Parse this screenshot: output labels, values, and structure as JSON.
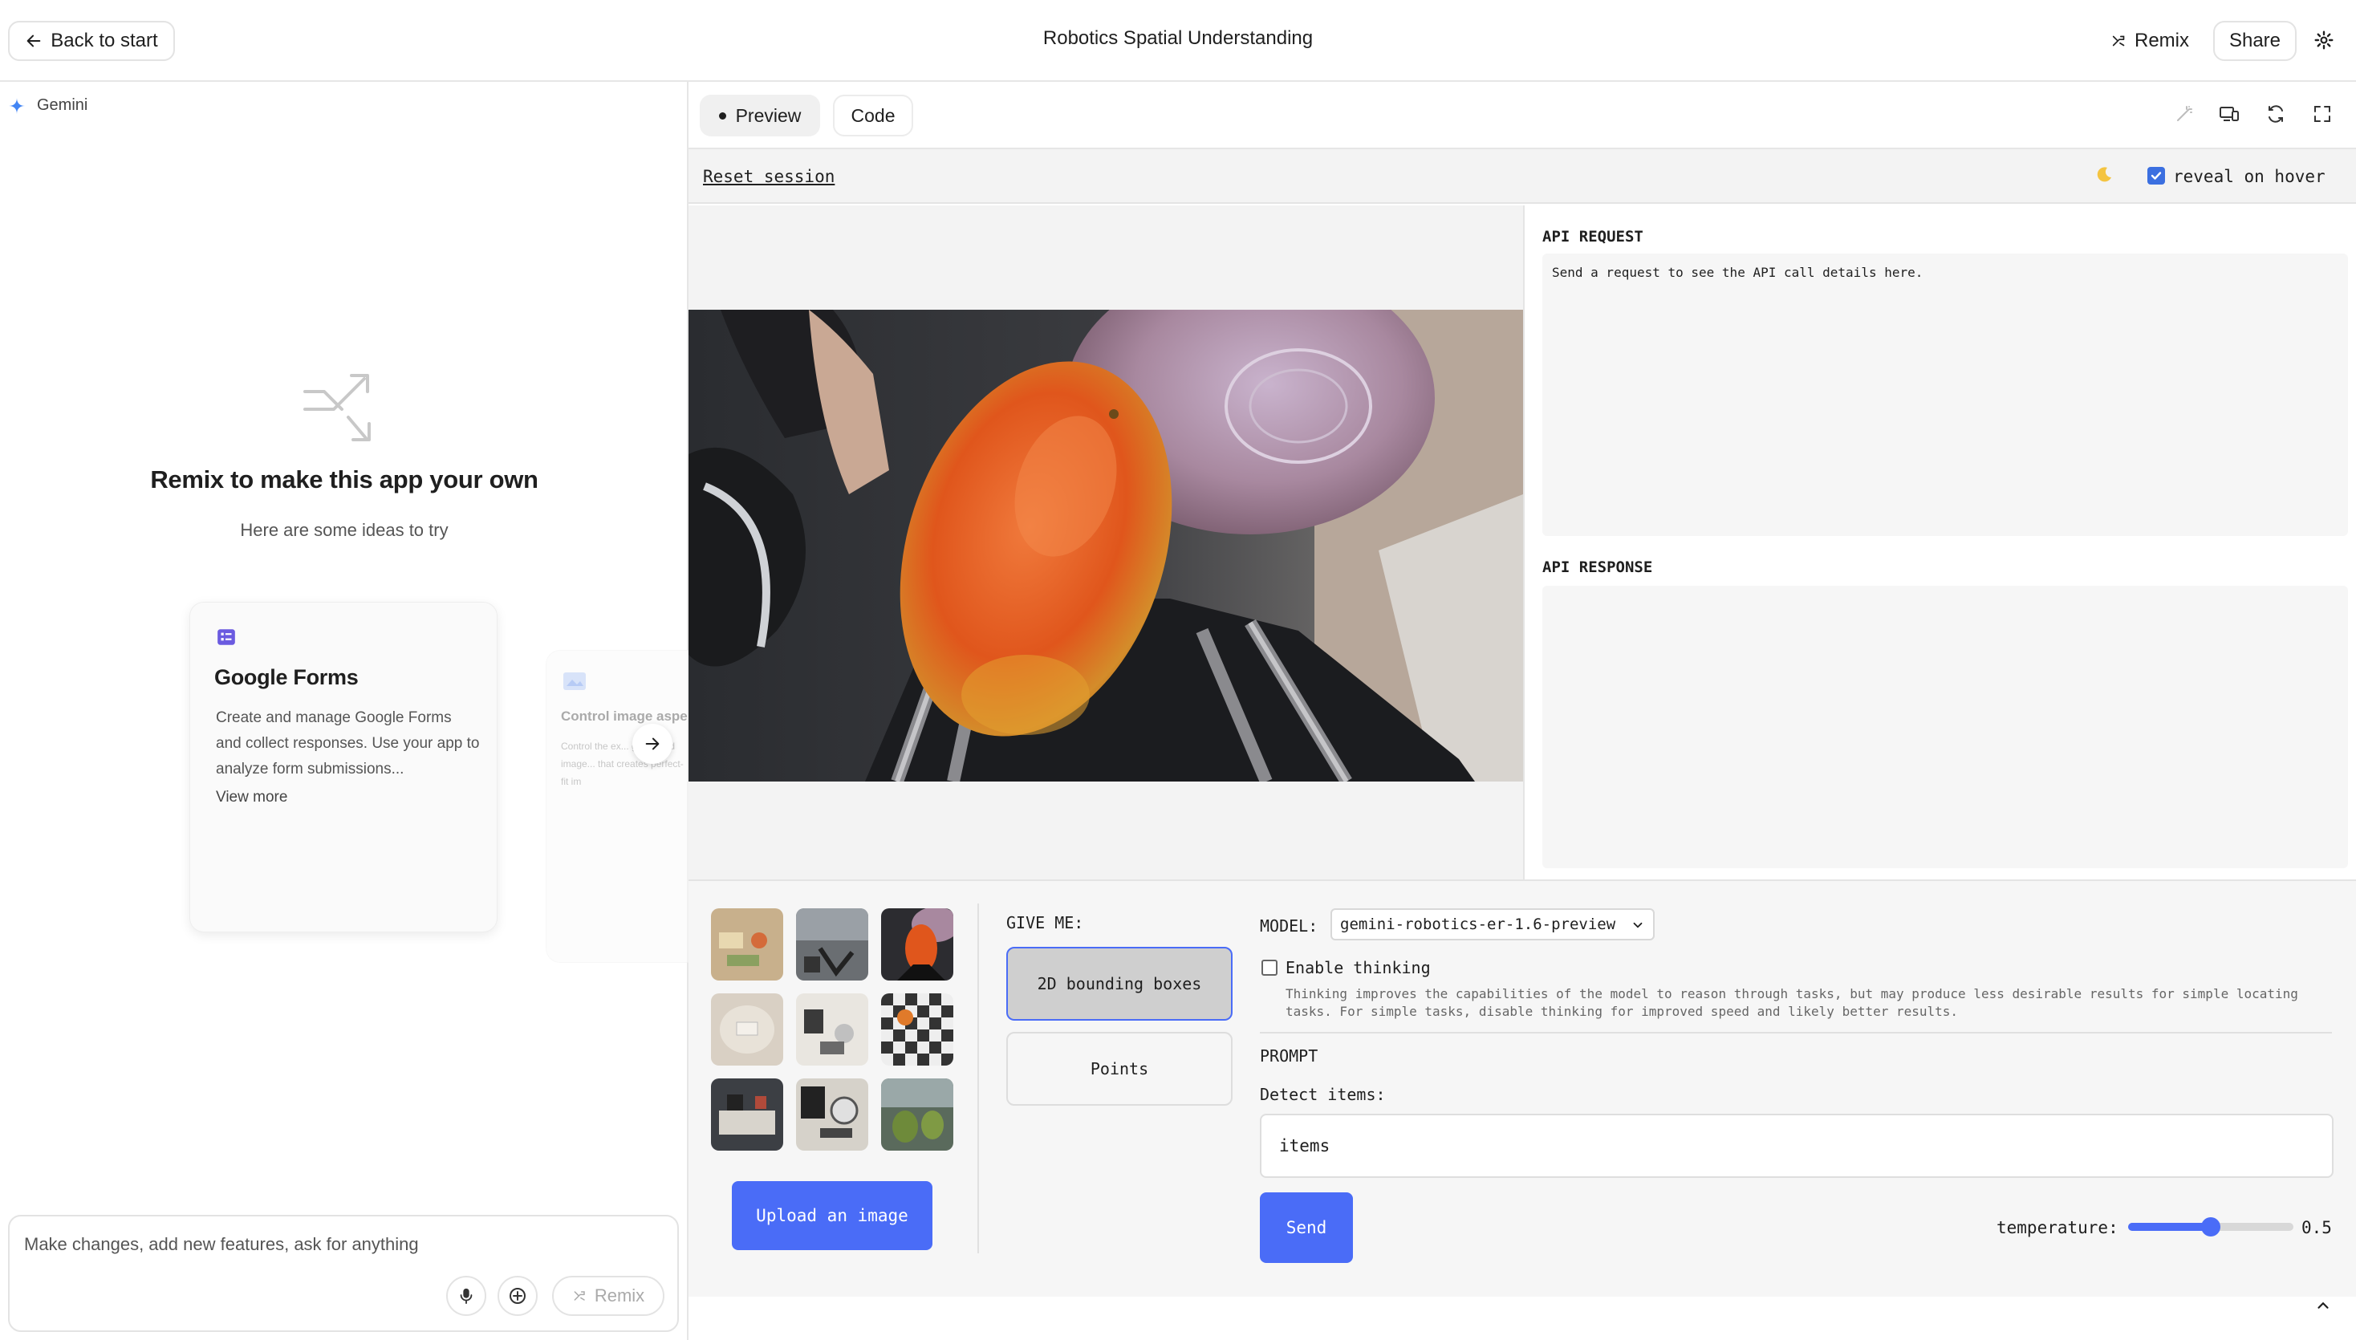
{
  "topbar": {
    "back_label": "Back to start",
    "title": "Robotics Spatial Understanding",
    "remix_label": "Remix",
    "share_label": "Share"
  },
  "left": {
    "model_label": "Gemini",
    "remix_heading": "Remix to make this app your own",
    "ideas_sub": "Here are some ideas to try",
    "card1": {
      "title": "Google Forms",
      "description": "Create and manage Google Forms and collect responses. Use your app to analyze form submissions...",
      "link": "View more"
    },
    "card2": {
      "title": "Control image aspe",
      "description": "Control the ex... generated image... that creates perfect-fit im"
    },
    "chat_placeholder": "Make changes, add new features, ask for anything",
    "chat_remix_label": "Remix"
  },
  "preview": {
    "tab_preview": "Preview",
    "tab_code": "Code",
    "reset_label": "Reset session",
    "reveal_label": "reveal on hover",
    "reveal_checked": true,
    "api_request_title": "API REQUEST",
    "api_request_text": "Send a request to see the API call details here.",
    "api_response_title": "API RESPONSE",
    "give_me_label": "GIVE ME:",
    "option_bbox": "2D bounding boxes",
    "option_points": "Points",
    "upload_label": "Upload an image",
    "model_label": "MODEL:",
    "model_value": "gemini-robotics-er-1.6-preview",
    "thinking_label": "Enable thinking",
    "thinking_desc": "Thinking improves the capabilities of the model to reason through tasks, but may produce less desirable results for simple locating tasks. For simple tasks, disable thinking for improved speed and likely better results.",
    "prompt_title": "PROMPT",
    "detect_label": "Detect items:",
    "detect_value": "items",
    "send_label": "Send",
    "temperature_label": "temperature:",
    "temperature_value": "0.5",
    "temperature_fraction": 0.5
  },
  "colors": {
    "accent_blue": "#4a6cf7",
    "gemini_blue": "#4285f4",
    "border": "#e3e3e3"
  },
  "icons": [
    "arrow-left-icon",
    "remix-icon",
    "gear-icon",
    "gemini-sparkle-icon",
    "remix-arrows-icon",
    "forms-icon",
    "image-aspect-icon",
    "arrow-right-icon",
    "mic-icon",
    "plus-circle-icon",
    "wand-icon",
    "devices-icon",
    "refresh-icon",
    "fullscreen-icon",
    "moon-icon",
    "chevron-down-icon",
    "chevron-up-icon"
  ]
}
